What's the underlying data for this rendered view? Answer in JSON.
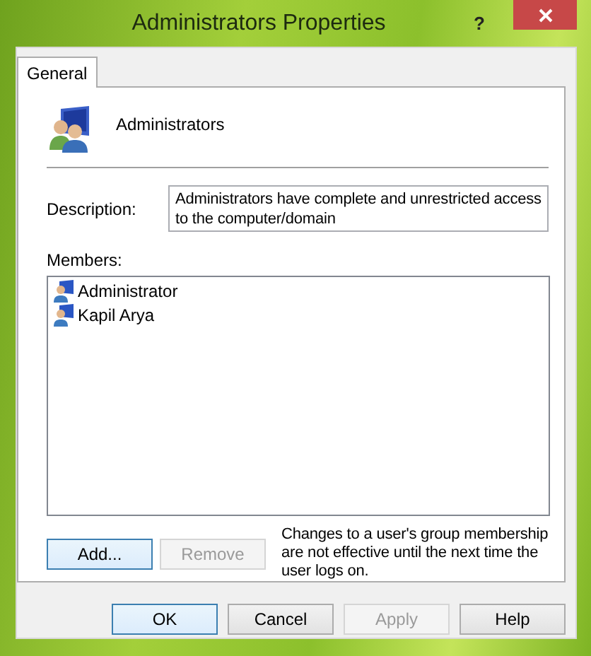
{
  "window": {
    "title": "Administrators Properties",
    "help_glyph": "?"
  },
  "tabs": [
    {
      "label": "General",
      "selected": true
    }
  ],
  "group": {
    "name": "Administrators"
  },
  "description": {
    "label": "Description:",
    "value": "Administrators have complete and unrestricted access to the computer/domain"
  },
  "members": {
    "label": "Members:",
    "items": [
      {
        "name": "Administrator"
      },
      {
        "name": "Kapil Arya"
      }
    ]
  },
  "member_buttons": [
    {
      "label": "Add...",
      "disabled": false,
      "highlighted": true
    },
    {
      "label": "Remove",
      "disabled": true,
      "highlighted": false
    }
  ],
  "note": "Changes to a user's group membership are not effective until the next time the user logs on.",
  "buttons": [
    {
      "label": "OK",
      "disabled": false,
      "highlighted": true
    },
    {
      "label": "Cancel",
      "disabled": false,
      "highlighted": false
    },
    {
      "label": "Apply",
      "disabled": true,
      "highlighted": false
    },
    {
      "label": "Help",
      "disabled": false,
      "highlighted": false
    }
  ]
}
